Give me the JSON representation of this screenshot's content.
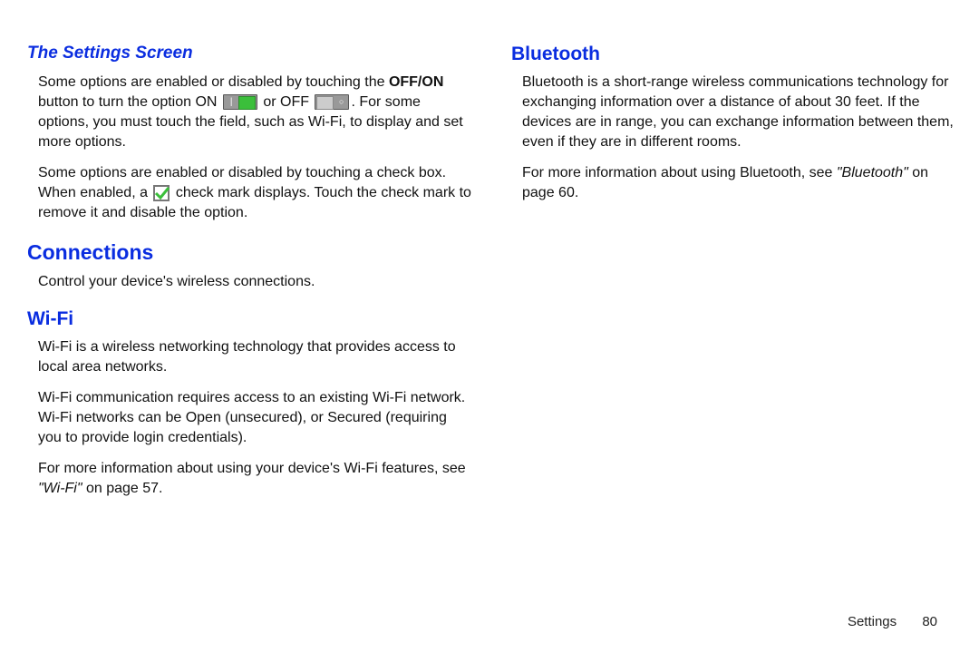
{
  "left": {
    "settings_screen_heading": "The Settings Screen",
    "p1_a": "Some options are enabled or disabled by touching the ",
    "p1_bold": "OFF/ON",
    "p1_b": " button to turn the option ON ",
    "p1_c": " or OFF ",
    "p1_d": ". For some options, you must touch the field, such as Wi-Fi, to display and set more options.",
    "p2_a": "Some options are enabled or disabled by touching a check box. When enabled, a ",
    "p2_b": " check mark displays. Touch the check mark to remove it and disable the option.",
    "connections_heading": "Connections",
    "connections_p": "Control your device's wireless connections.",
    "wifi_heading": "Wi-Fi",
    "wifi_p1": "Wi-Fi is a wireless networking technology that provides access to local area networks.",
    "wifi_p2": "Wi-Fi communication requires access to an existing Wi-Fi network. Wi-Fi networks can be Open (unsecured), or Secured (requiring you to provide login credentials).",
    "wifi_p3_a": "For more information about using your device's Wi-Fi features, see ",
    "wifi_p3_xref": "\"Wi-Fi\"",
    "wifi_p3_b": " on page 57."
  },
  "right": {
    "bluetooth_heading": "Bluetooth",
    "bt_p1": "Bluetooth is a short-range wireless communications technology for exchanging information over a distance of about 30 feet. If the devices are in range, you can exchange information between them, even if they are in different rooms.",
    "bt_p2_a": "For more information about using Bluetooth, see ",
    "bt_p2_xref": "\"Bluetooth\"",
    "bt_p2_b": " on page 60."
  },
  "footer": {
    "section": "Settings",
    "page": "80"
  }
}
